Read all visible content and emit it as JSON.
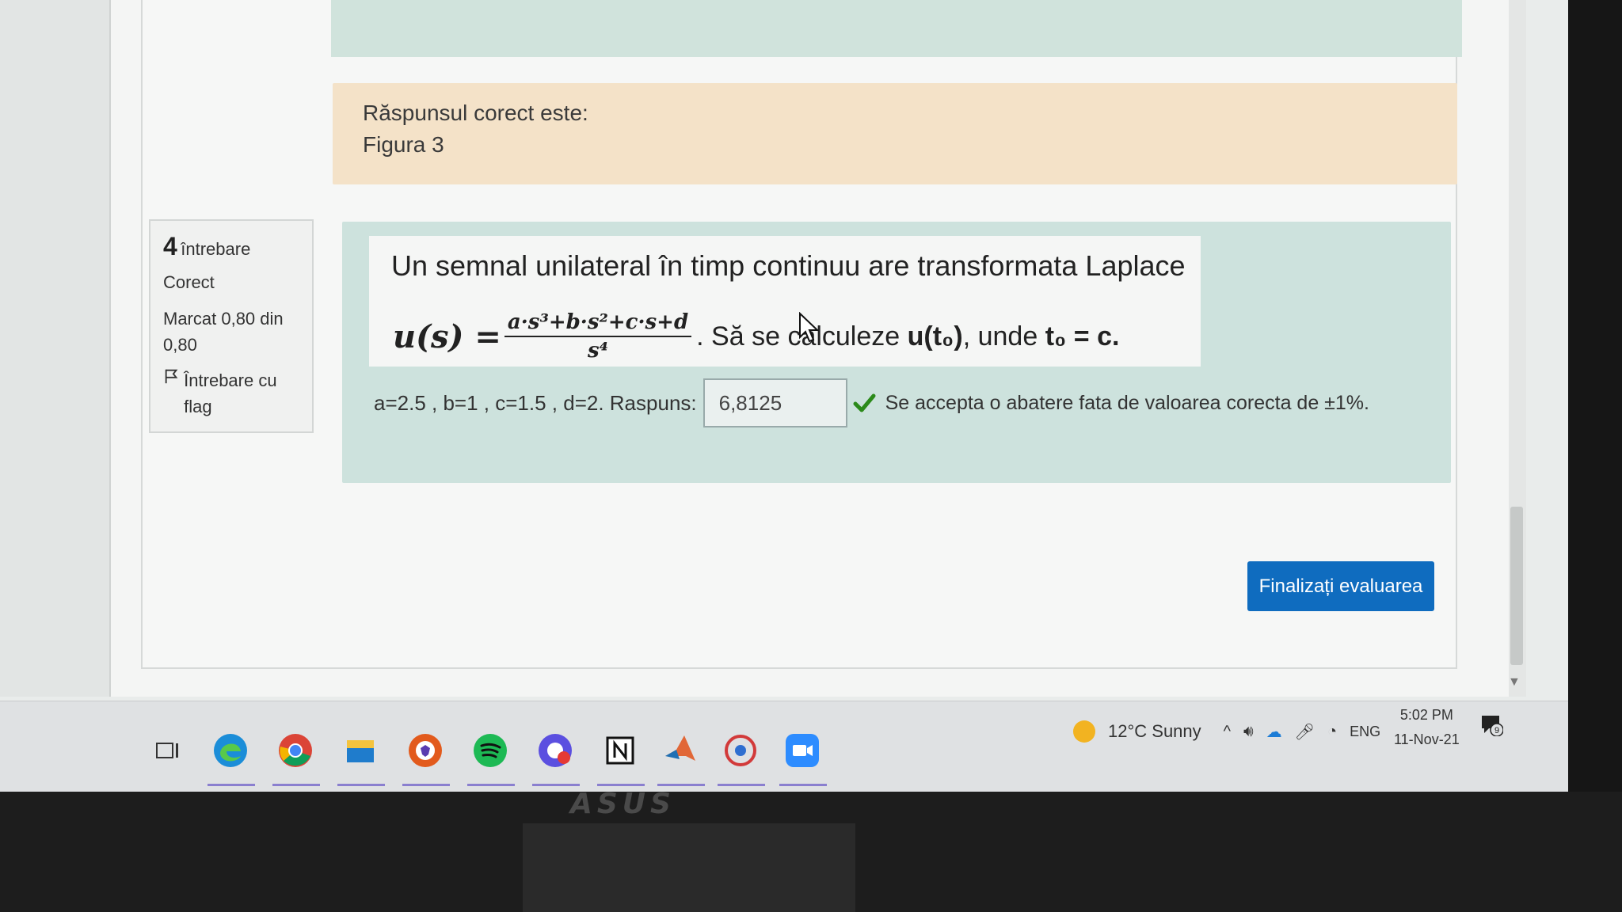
{
  "previous_feedback": {
    "correct_answer_label": "Răspunsul corect este:",
    "correct_answer_value": "Figura 3"
  },
  "question_info": {
    "number": "4",
    "label": "întrebare",
    "state": "Corect",
    "grade": "Marcat 0,80 din 0,80",
    "flag_label": "Întrebare cu flag",
    "flag_icon": "flag-outline-icon"
  },
  "question": {
    "intro": "Un semnal unilateral în timp continuu are transformata Laplace",
    "formula_lhs": "u(s) =",
    "formula_numerator": "a·s³+b·s²+c·s+d",
    "formula_denominator": "s⁴",
    "formula_rest_plain": ". Să se calculeze ",
    "formula_rest_bold1": "u(t₀)",
    "formula_rest_plain2": ", unde ",
    "formula_rest_bold2": "t₀ = c.",
    "params": "a=2.5 , b=1 , c=1.5 , d=2. Raspuns:",
    "answer_value": "6,8125",
    "answer_status_icon": "check-icon",
    "tolerance_note": "Se accepta o abatere fata de valoarea corecta de ±1%."
  },
  "actions": {
    "finish_label": "Finalizați evaluarea"
  },
  "taskbar": {
    "apps": [
      "task-view-icon",
      "edge-icon",
      "chrome-icon",
      "file-explorer-icon",
      "brave-icon",
      "spotify-icon",
      "messenger-icon",
      "notion-icon",
      "matlab-icon",
      "app-icon",
      "zoom-icon"
    ],
    "weather": "12°C  Sunny",
    "language": "ENG",
    "time": "5:02 PM",
    "date": "11-Nov-21",
    "notification_count": "9",
    "brand": "ASUS"
  },
  "colors": {
    "correct_answer_bg": "#f4e2c8",
    "question_bg": "#cde2dd",
    "button_bg": "#0f6cbf",
    "check_green": "#2b8a1a"
  }
}
